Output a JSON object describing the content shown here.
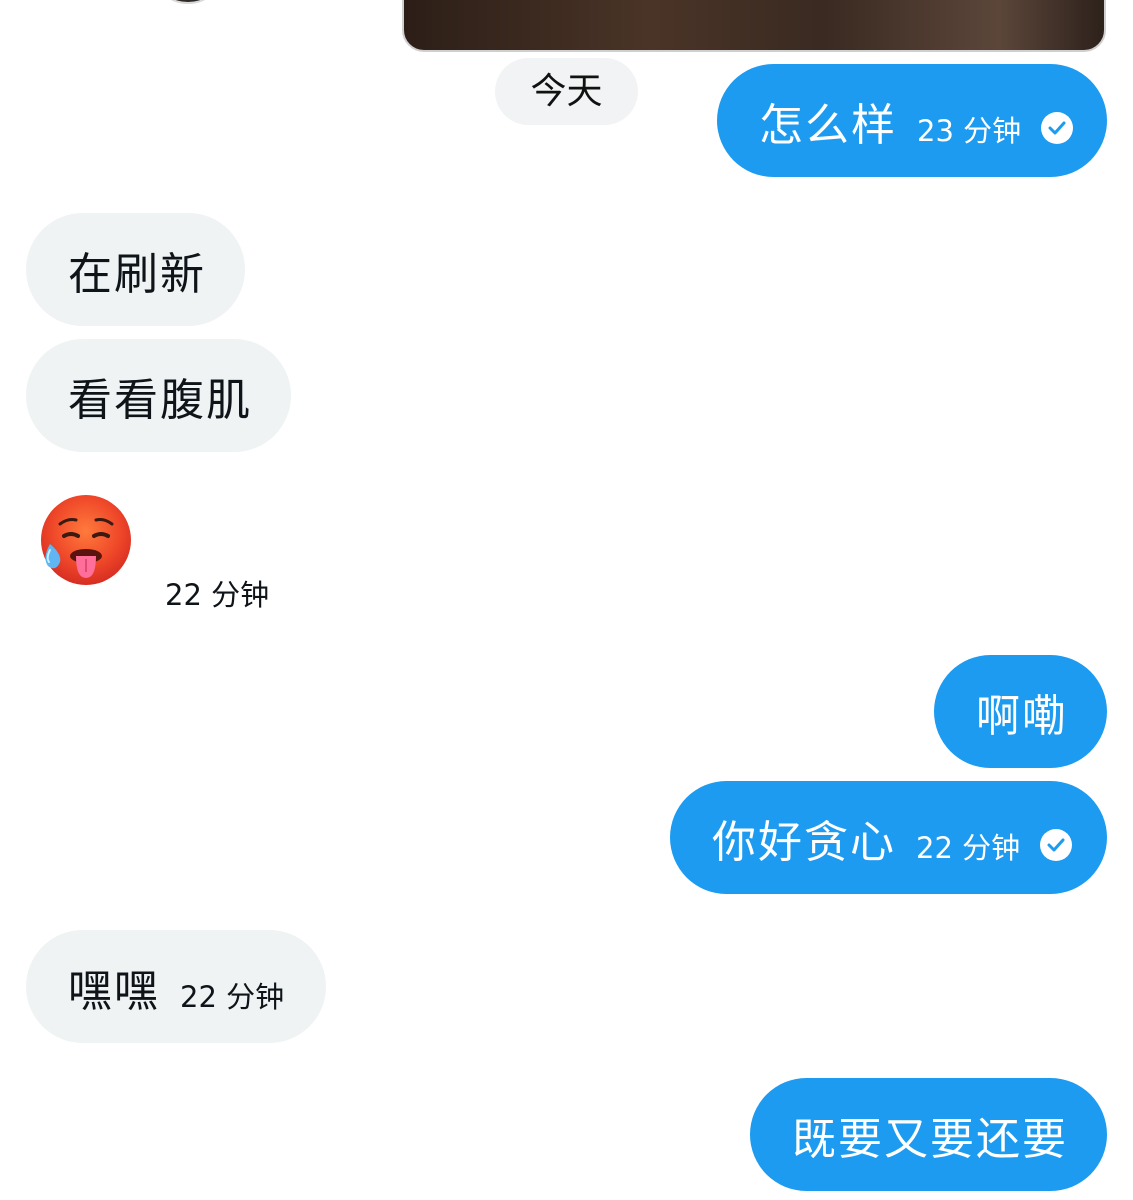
{
  "conversation": {
    "day_separator": "今天",
    "messages": [
      {
        "id": "m1",
        "direction": "outgoing",
        "text": "怎么样",
        "time": "23 分钟",
        "read_icon": "check-circle-icon"
      },
      {
        "id": "m2",
        "direction": "incoming",
        "text": "在刷新"
      },
      {
        "id": "m3",
        "direction": "incoming",
        "text": "看看腹肌"
      },
      {
        "id": "m4",
        "direction": "incoming",
        "emoji": "hot-face-emoji",
        "time": "22 分钟"
      },
      {
        "id": "m5",
        "direction": "outgoing",
        "text": "啊嘞"
      },
      {
        "id": "m6",
        "direction": "outgoing",
        "text": "你好贪心",
        "time": "22 分钟",
        "read_icon": "check-circle-icon"
      },
      {
        "id": "m7",
        "direction": "incoming",
        "text": "嘿嘿",
        "time": "22 分钟"
      },
      {
        "id": "m8",
        "direction": "outgoing",
        "text": "既要又要还要"
      }
    ]
  },
  "colors": {
    "outgoing_bubble": "#1d9bf0",
    "incoming_bubble": "#eff3f4",
    "day_pill": "#f1f3f4",
    "text_dark": "#0f1419"
  }
}
